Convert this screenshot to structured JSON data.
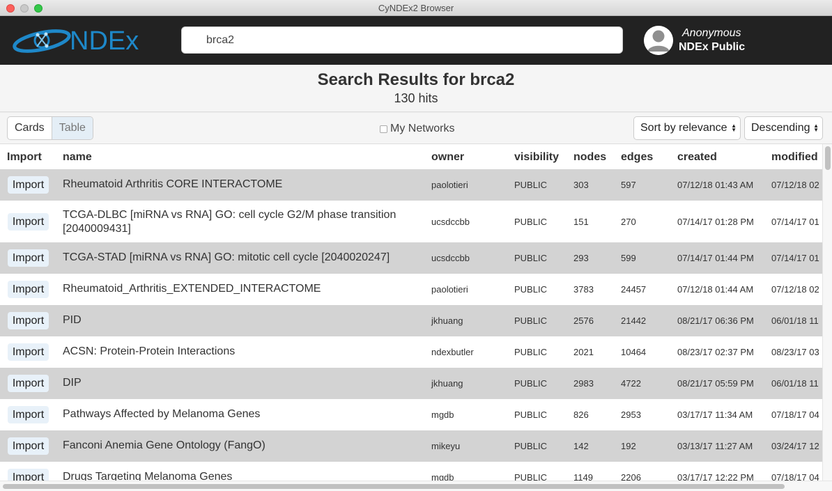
{
  "window": {
    "title": "CyNDEx2 Browser"
  },
  "header": {
    "logo_text": "NDEx",
    "search": {
      "value": "brca2"
    },
    "user": {
      "name": "Anonymous",
      "server": "NDEx Public"
    }
  },
  "results": {
    "title": "Search Results for brca2",
    "hits": "130 hits"
  },
  "toolbar": {
    "view_cards": "Cards",
    "view_table": "Table",
    "my_networks": "My Networks",
    "sort": "Sort by relevance",
    "order": "Descending"
  },
  "table": {
    "columns": [
      "Import",
      "name",
      "owner",
      "visibility",
      "nodes",
      "edges",
      "created",
      "modified"
    ],
    "import_label": "Import",
    "rows": [
      {
        "name": "Rheumatoid Arthritis CORE INTERACTOME",
        "owner": "paolotieri",
        "visibility": "PUBLIC",
        "nodes": "303",
        "edges": "597",
        "created": "07/12/18 01:43 AM",
        "modified": "07/12/18 02"
      },
      {
        "name": "TCGA-DLBC [miRNA vs RNA] GO: cell cycle G2/M phase transition [2040009431]",
        "owner": "ucsdccbb",
        "visibility": "PUBLIC",
        "nodes": "151",
        "edges": "270",
        "created": "07/14/17 01:28 PM",
        "modified": "07/14/17 01"
      },
      {
        "name": "TCGA-STAD [miRNA vs RNA] GO: mitotic cell cycle [2040020247]",
        "owner": "ucsdccbb",
        "visibility": "PUBLIC",
        "nodes": "293",
        "edges": "599",
        "created": "07/14/17 01:44 PM",
        "modified": "07/14/17 01"
      },
      {
        "name": "Rheumatoid_Arthritis_EXTENDED_INTERACTOME",
        "owner": "paolotieri",
        "visibility": "PUBLIC",
        "nodes": "3783",
        "edges": "24457",
        "created": "07/12/18 01:44 AM",
        "modified": "07/12/18 02"
      },
      {
        "name": "PID",
        "owner": "jkhuang",
        "visibility": "PUBLIC",
        "nodes": "2576",
        "edges": "21442",
        "created": "08/21/17 06:36 PM",
        "modified": "06/01/18 11"
      },
      {
        "name": "ACSN: Protein-Protein Interactions",
        "owner": "ndexbutler",
        "visibility": "PUBLIC",
        "nodes": "2021",
        "edges": "10464",
        "created": "08/23/17 02:37 PM",
        "modified": "08/23/17 03"
      },
      {
        "name": "DIP",
        "owner": "jkhuang",
        "visibility": "PUBLIC",
        "nodes": "2983",
        "edges": "4722",
        "created": "08/21/17 05:59 PM",
        "modified": "06/01/18 11"
      },
      {
        "name": "Pathways Affected by Melanoma Genes",
        "owner": "mgdb",
        "visibility": "PUBLIC",
        "nodes": "826",
        "edges": "2953",
        "created": "03/17/17 11:34 AM",
        "modified": "07/18/17 04"
      },
      {
        "name": "Fanconi Anemia Gene Ontology (FangO)",
        "owner": "mikeyu",
        "visibility": "PUBLIC",
        "nodes": "142",
        "edges": "192",
        "created": "03/13/17 11:27 AM",
        "modified": "03/24/17 12"
      },
      {
        "name": "Drugs Targeting Melanoma Genes",
        "owner": "mgdb",
        "visibility": "PUBLIC",
        "nodes": "1149",
        "edges": "2206",
        "created": "03/17/17 12:22 PM",
        "modified": "07/18/17 04"
      }
    ]
  },
  "colors": {
    "header_bg": "#222222",
    "row_shade": "#d3d3d3",
    "logo_blue": "#1e88c9",
    "import_bg": "#e8f1f9"
  }
}
